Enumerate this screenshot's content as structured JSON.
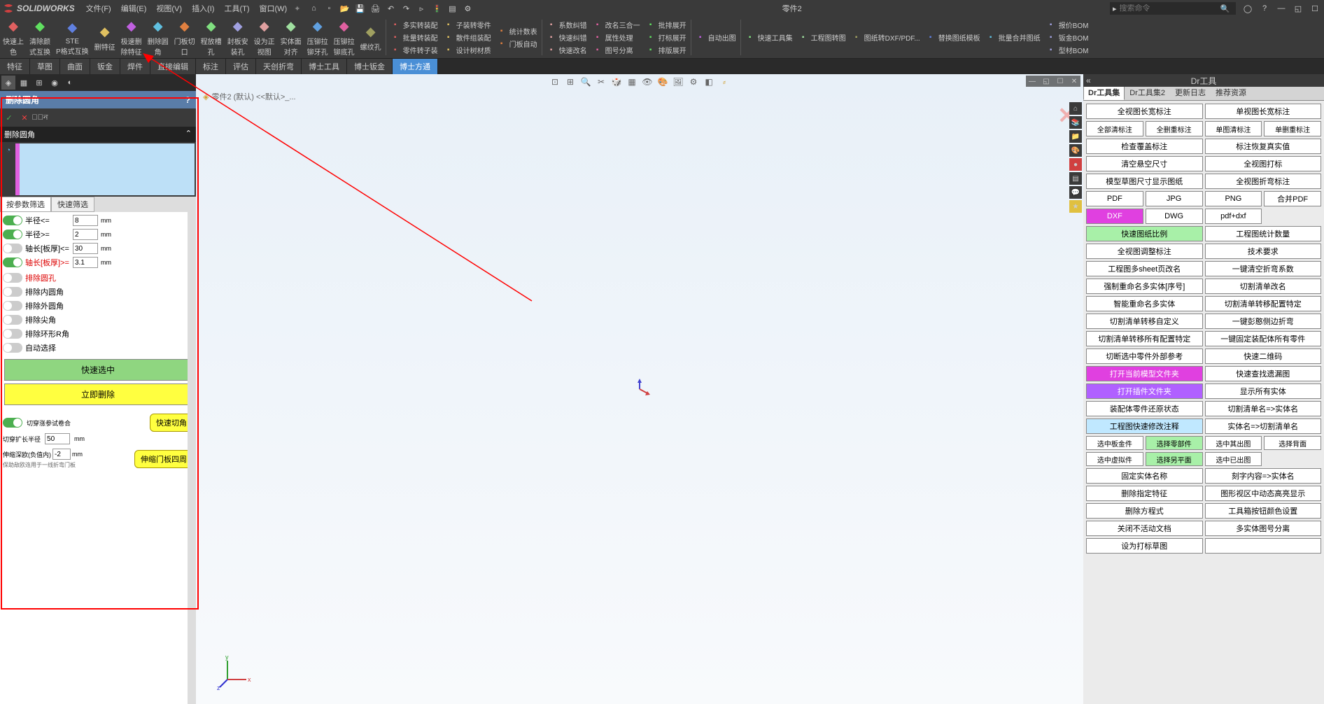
{
  "app": {
    "name": "SOLIDWORKS",
    "doc_title": "零件2"
  },
  "menu": [
    "文件(F)",
    "编辑(E)",
    "视图(V)",
    "插入(I)",
    "工具(T)",
    "窗口(W)"
  ],
  "search_placeholder": "搜索命令",
  "ribbon_large": [
    "快速上色",
    "清除颜式互换",
    "STEP格式互换",
    "删特征",
    "极速删除特征",
    "删除圆角",
    "门板切口",
    "程放槽孔",
    "封板安装孔",
    "设为正视图",
    "实体面对齐",
    "压铆拉铆牙孔",
    "压铆拉铆底孔",
    "螺纹孔"
  ],
  "ribbon_cols": [
    [
      "多实转装配",
      "批量转装配",
      "零件转子装"
    ],
    [
      "子装转零件",
      "散件组装配",
      "设计树材质"
    ],
    [
      "统计数表",
      "门板自动"
    ],
    [
      "系数纠错",
      "快速纠错",
      "快速改名"
    ],
    [
      "改名三合一",
      "属性处理",
      "图号分离"
    ],
    [
      "批排展开",
      "打标展开",
      "排版展开"
    ],
    [
      "自动出图"
    ],
    [
      "快速工具集"
    ],
    [
      "工程图转图"
    ],
    [
      "图纸转DXF/PDF..."
    ],
    [
      "替换图纸模板"
    ],
    [
      "批量合并图纸"
    ],
    [
      "报价BOM",
      "钣金BOM",
      "型材BOM"
    ]
  ],
  "tabs": [
    "特征",
    "草图",
    "曲面",
    "钣金",
    "焊件",
    "直接编辑",
    "标注",
    "评估",
    "天创折弯",
    "博士工具",
    "博士钣金",
    "博士方通"
  ],
  "active_tab": 11,
  "panel": {
    "title": "删除圆角",
    "section1": "删除圆角",
    "filter_tabs": [
      "按参数筛选",
      "快速筛选"
    ],
    "params": [
      {
        "on": true,
        "label": "半径<=",
        "value": "8"
      },
      {
        "on": true,
        "label": "半径>=",
        "value": "2"
      },
      {
        "on": false,
        "label": "轴长[板厚]<=",
        "value": "30"
      },
      {
        "on": true,
        "label": "轴长[板厚]>=",
        "value": "3.1",
        "red": true
      }
    ],
    "flags": [
      {
        "on": false,
        "label": "排除圆孔",
        "red": true
      },
      {
        "on": false,
        "label": "排除内圆角"
      },
      {
        "on": false,
        "label": "排除外圆角"
      },
      {
        "on": false,
        "label": "排除尖角"
      },
      {
        "on": false,
        "label": "排除环形R角"
      },
      {
        "on": false,
        "label": "自动选择"
      }
    ],
    "btn_select": "快速选中",
    "btn_delete": "立即删除",
    "opt1_label": "切穿涨参试卷合",
    "opt1_sub": "切穿扩长半径",
    "opt1_val": "50",
    "btn_fillet": "快速切角",
    "opt2_label": "伸缩深欧(负值内)",
    "opt2_val": "-2",
    "opt2_sub": "保助敌欧连用于一线折弯门板",
    "btn_shrink": "伸缩门板四周"
  },
  "doc_tab": "零件2 (默认) <<默认>_...",
  "right": {
    "title": "Dr工具",
    "tabs": [
      "Dr工具集",
      "Dr工具集2",
      "更新日志",
      "推荐资源"
    ],
    "rows": [
      [
        {
          "t": "全视图长宽标注"
        },
        {
          "t": "单视图长宽标注"
        }
      ],
      [
        {
          "t": "全部清标注",
          "w": "h"
        },
        {
          "t": "全删重标注",
          "w": "h"
        },
        {
          "t": "单图清标注",
          "w": "h"
        },
        {
          "t": "单删重标注",
          "w": "h"
        }
      ],
      [
        {
          "t": "检查覆盖标注"
        },
        {
          "t": "标注恢复真实值"
        }
      ],
      [
        {
          "t": "清空悬空尺寸"
        },
        {
          "t": "全视图打标"
        }
      ],
      [
        {
          "t": "模型草图尺寸显示图纸"
        },
        {
          "t": "全视图折弯标注"
        }
      ],
      [
        {
          "t": "PDF",
          "w": "q"
        },
        {
          "t": "JPG",
          "w": "q"
        },
        {
          "t": "PNG",
          "w": "q"
        },
        {
          "t": "合并PDF",
          "w": "q"
        }
      ],
      [
        {
          "t": "DXF",
          "c": "magenta",
          "w": "q"
        },
        {
          "t": "DWG",
          "w": "q"
        },
        {
          "t": "pdf+dxf",
          "w": "q"
        },
        {
          "t": "",
          "w": "q",
          "e": true
        }
      ],
      [
        {
          "t": "快速图纸比例",
          "c": "green"
        },
        {
          "t": "工程图统计数量"
        }
      ],
      [
        {
          "t": "全视图调整标注"
        },
        {
          "t": "技术要求"
        }
      ],
      [
        {
          "t": "工程图多sheet页改名"
        },
        {
          "t": "一键清空折弯系数"
        }
      ],
      [
        {
          "t": "强制重命名多实体[序号]"
        },
        {
          "t": "切割清单改名"
        }
      ],
      [
        {
          "t": "智能重命名多实体"
        },
        {
          "t": "切割清单转移配置特定"
        }
      ],
      [
        {
          "t": "切割清单转移自定义"
        },
        {
          "t": "一键彭憨侧边折弯"
        }
      ],
      [
        {
          "t": "切割清单转移所有配置特定"
        },
        {
          "t": "一键固定装配体所有零件"
        }
      ],
      [
        {
          "t": "切断选中零件外部参考"
        },
        {
          "t": "快速二维码"
        }
      ],
      [
        {
          "t": "打开当前模型文件夹",
          "c": "magenta"
        },
        {
          "t": "快速查找遗漏图"
        }
      ],
      [
        {
          "t": "打开插件文件夹",
          "c": "purple"
        },
        {
          "t": "显示所有实体"
        }
      ],
      [
        {
          "t": "装配体零件还原状态"
        },
        {
          "t": "切割清单名=>实体名"
        }
      ],
      [
        {
          "t": "工程图快速修改注释",
          "c": "cyan"
        },
        {
          "t": "实体名=>切割清单名"
        }
      ],
      [
        {
          "t": "选中板金件",
          "w": "s"
        },
        {
          "t": "选择零部件",
          "w": "s",
          "c": "green"
        },
        {
          "t": "选中其出图",
          "w": "s"
        },
        {
          "t": "选择背面",
          "w": "s"
        }
      ],
      [
        {
          "t": "选中虚拟件",
          "w": "s"
        },
        {
          "t": "选择另平面",
          "w": "s",
          "c": "green"
        },
        {
          "t": "选中已出图",
          "w": "s"
        },
        {
          "t": "",
          "w": "s",
          "e": true
        }
      ],
      [
        {
          "t": "固定实体名称"
        },
        {
          "t": "刻字内容=>实体名"
        }
      ],
      [
        {
          "t": "删除指定特征"
        },
        {
          "t": "图形视区中动态高亮显示"
        }
      ],
      [
        {
          "t": "删除方程式"
        },
        {
          "t": "工具箱按钮颜色设置"
        }
      ],
      [
        {
          "t": "关闭不活动文档"
        },
        {
          "t": "多实体图号分离"
        }
      ],
      [
        {
          "t": "设为打标草图"
        },
        {
          "t": ""
        }
      ]
    ]
  }
}
